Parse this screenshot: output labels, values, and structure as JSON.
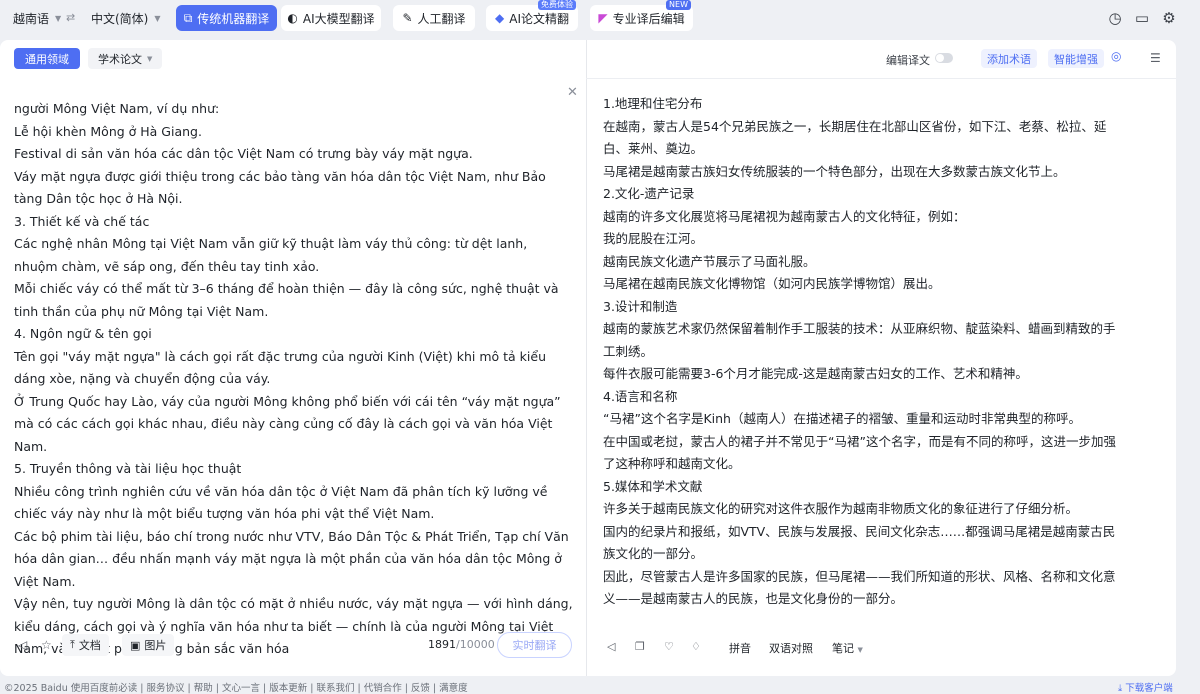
{
  "topbar": {
    "source_lang": "越南语",
    "target_lang": "中文(简体)",
    "swap_icon": "swap-arrows-icon",
    "modes": [
      {
        "label": "传统机器翻译",
        "icon": "translate-icon",
        "active": true
      },
      {
        "label": "AI大模型翻译",
        "icon": "ai-model-icon",
        "active": false
      },
      {
        "label": "人工翻译",
        "icon": "human-translate-icon",
        "active": false
      },
      {
        "label": "AI论文精翻",
        "icon": "paper-icon",
        "active": false,
        "badge": "免费体验"
      },
      {
        "label": "专业译后编辑",
        "icon": "edit-icon",
        "active": false,
        "badge": "NEW"
      }
    ],
    "right_icons": [
      "history-icon",
      "folder-icon",
      "settings-icon"
    ]
  },
  "source": {
    "domain_label": "通用领域",
    "paper_label": "学术论文",
    "lines": [
      "người Mông Việt Nam, ví dụ như:",
      "Lễ hội khèn Mông ở Hà Giang.",
      "Festival di sản văn hóa các dân tộc Việt Nam có trưng bày váy mặt ngựa.",
      "Váy mặt ngựa được giới thiệu trong các bảo tàng văn hóa dân tộc Việt Nam, như Bảo tàng Dân tộc học ở Hà Nội.",
      "3. Thiết kế và chế tác",
      "Các nghệ nhân Mông tại Việt Nam vẫn giữ kỹ thuật làm váy thủ công: từ dệt lanh, nhuộm chàm, vẽ sáp ong, đến thêu tay tinh xảo.",
      "Mỗi chiếc váy có thể mất từ 3–6 tháng để hoàn thiện — đây là công sức, nghệ thuật và tinh thần của phụ nữ Mông tại Việt Nam.",
      "4. Ngôn ngữ & tên gọi",
      "Tên gọi \"váy mặt ngựa\" là cách gọi rất đặc trưng của người Kinh (Việt) khi mô tả kiểu dáng xòe, nặng và chuyển động của váy.",
      "Ở Trung Quốc hay Lào, váy của người Mông không phổ biến với cái tên “váy mặt ngựa” mà có các cách gọi khác nhau, điều này càng củng cố đây là cách gọi và văn hóa Việt Nam.",
      "5. Truyền thông và tài liệu học thuật",
      "Nhiều công trình nghiên cứu về văn hóa dân tộc ở Việt Nam đã phân tích kỹ lưỡng về chiếc váy này như là một biểu tượng văn hóa phi vật thể Việt Nam.",
      "Các bộ phim tài liệu, báo chí trong nước như VTV, Báo Dân Tộc & Phát Triển, Tạp chí Văn hóa dân gian… đều nhấn mạnh váy mặt ngựa là một phần của văn hóa dân tộc Mông ở Việt Nam.",
      "Vậy nên, tuy người Mông là dân tộc có mặt ở nhiều nước, váy mặt ngựa — với hình dáng, kiểu dáng, cách gọi và ý nghĩa văn hóa như ta biết — chính là của người Mông tại Việt Nam, và là một phần trong bản sắc văn hóa"
    ],
    "footer": {
      "doc_label": "文档",
      "image_label": "图片",
      "count": "1891",
      "max": "/10000",
      "realtime_label": "实时翻译"
    }
  },
  "target": {
    "edit_label": "编辑译文",
    "add_term_label": "添加术语",
    "enhance_label": "智能增强",
    "lines": [
      "1.地理和住宅分布",
      "在越南，蒙古人是54个兄弟民族之一，长期居住在北部山区省份，如下江、老蔡、松拉、延白、莱州、奠边。",
      "马尾裙是越南蒙古族妇女传统服装的一个特色部分，出现在大多数蒙古族文化节上。",
      "2.文化-遗产记录",
      "越南的许多文化展览将马尾裙视为越南蒙古人的文化特征，例如：",
      "我的屁股在江河。",
      "越南民族文化遗产节展示了马面礼服。",
      "马尾裙在越南民族文化博物馆（如河内民族学博物馆）展出。",
      "3.设计和制造",
      "越南的蒙族艺术家仍然保留着制作手工服装的技术：从亚麻织物、靛蓝染料、蜡画到精致的手工刺绣。",
      "每件衣服可能需要3-6个月才能完成-这是越南蒙古妇女的工作、艺术和精神。",
      "4.语言和名称",
      "“马裙”这个名字是Kinh（越南人）在描述裙子的褶皱、重量和运动时非常典型的称呼。",
      "在中国或老挝，蒙古人的裙子并不常见于“马裙”这个名字，而是有不同的称呼，这进一步加强了这种称呼和越南文化。",
      "5.媒体和学术文献",
      "许多关于越南民族文化的研究对这件衣服作为越南非物质文化的象征进行了仔细分析。",
      "国内的纪录片和报纸，如VTV、民族与发展报、民间文化杂志……都强调马尾裙是越南蒙古民族文化的一部分。",
      "因此，尽管蒙古人是许多国家的民族，但马尾裙——我们所知道的形状、风格、名称和文化意义——是越南蒙古人的民族，也是文化身份的一部分。"
    ],
    "footer": {
      "pinyin_label": "拼音",
      "bilingual_label": "双语对照",
      "notes_label": "笔记"
    }
  },
  "bottom": {
    "links": "©2025 Baidu   使用百度前必读 | 服务协议 | 帮助 | 文心一言 | 版本更新 | 联系我们 | 代销合作 | 反馈 | 满意度",
    "download": "下载客户端"
  }
}
